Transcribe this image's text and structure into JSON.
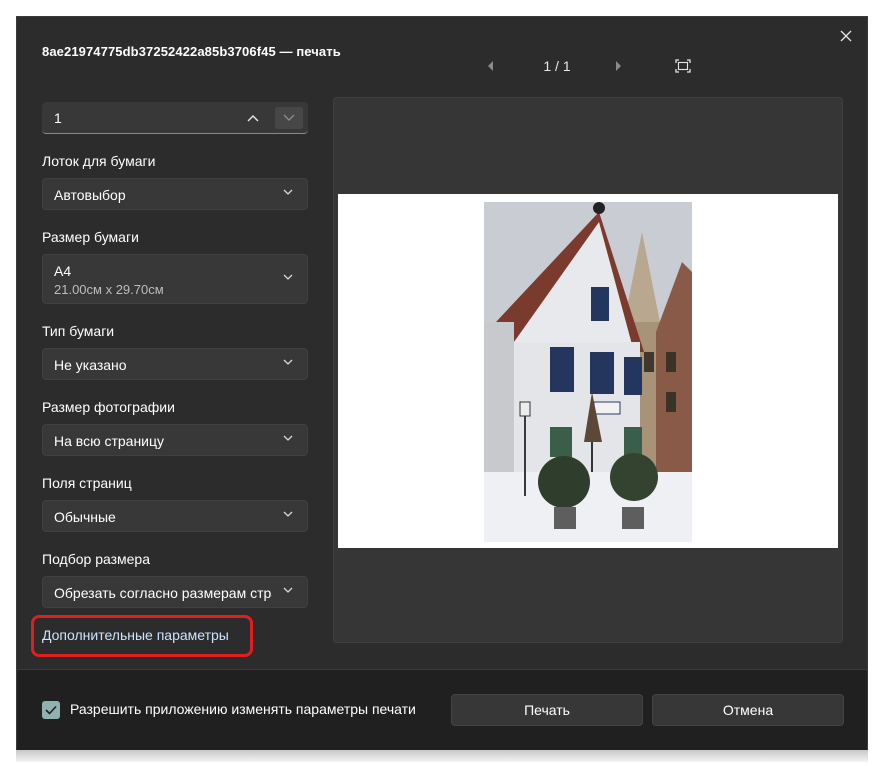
{
  "window": {
    "title": "8ae21974775db37252422a85b3706f45 — печать"
  },
  "pager": {
    "text": "1 / 1"
  },
  "copies": {
    "value": "1"
  },
  "settings": {
    "tray_label": "Лоток для бумаги",
    "tray_value": "Автовыбор",
    "size_label": "Размер бумаги",
    "size_value": "A4",
    "size_dims": "21.00см x 29.70см",
    "type_label": "Тип бумаги",
    "type_value": "Не указано",
    "photo_label": "Размер фотографии",
    "photo_value": "На всю страницу",
    "margins_label": "Поля страниц",
    "margins_value": "Обычные",
    "fit_label": "Подбор размера",
    "fit_value": "Обрезать согласно размерам стра"
  },
  "more_settings": "Дополнительные параметры",
  "footer": {
    "allow_label": "Разрешить приложению изменять параметры печати",
    "allow_checked": true,
    "print_label": "Печать",
    "cancel_label": "Отмена"
  },
  "colors": {
    "dialog_bg": "#2c2c2c",
    "footer_bg": "#202020",
    "highlight": "#e01e1e",
    "checkbox": "#8fb2b0"
  },
  "icons": [
    "close-icon",
    "chevron-left-icon",
    "chevron-right-icon",
    "fit-page-icon",
    "chevron-up-icon",
    "chevron-down-icon",
    "checkmark-icon"
  ]
}
